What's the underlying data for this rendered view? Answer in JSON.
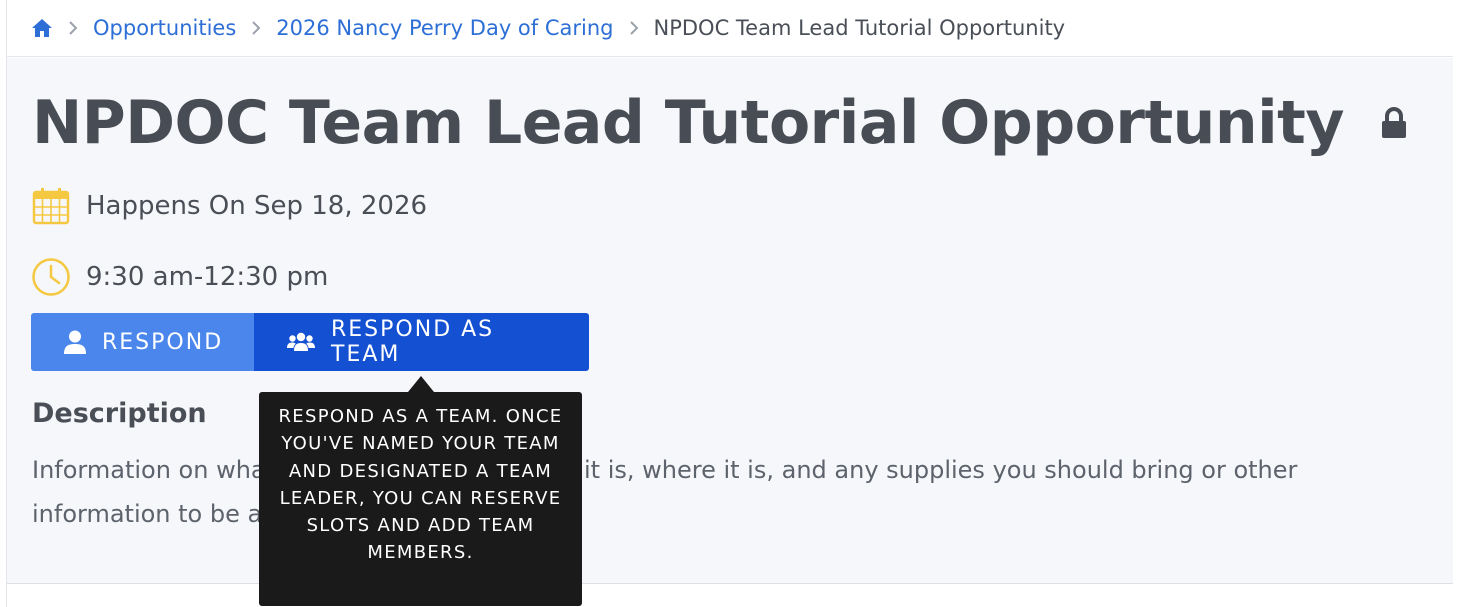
{
  "breadcrumb": {
    "items": [
      {
        "label": "Opportunities"
      },
      {
        "label": "2026 Nancy Perry Day of Caring"
      }
    ],
    "current": "NPDOC Team Lead Tutorial Opportunity"
  },
  "page": {
    "title": "NPDOC Team Lead Tutorial Opportunity",
    "date_text": "Happens On Sep 18, 2026",
    "time_text": "9:30 am-12:30 pm"
  },
  "actions": {
    "respond_label": "RESPOND",
    "respond_team_label": "RESPOND AS TEAM"
  },
  "description": {
    "heading": "Description",
    "text": "Information on what the opportunity is, when it is, where it is, and any supplies you should bring or other information to be aware of."
  },
  "tooltip": {
    "text": "RESPOND AS A TEAM. ONCE YOU'VE NAMED YOUR TEAM AND DESIGNATED A TEAM LEADER, YOU CAN RESERVE SLOTS AND ADD TEAM MEMBERS."
  },
  "icons": {
    "home": "home-icon",
    "separator": "chevron-right-icon",
    "lock": "lock-icon",
    "calendar": "calendar-icon",
    "clock": "clock-icon",
    "user": "user-icon",
    "team": "users-icon"
  },
  "colors": {
    "link": "#2d6fd6",
    "respond_button": "#4a86ec",
    "respond_team_button": "#1450d2",
    "meta_icon": "#f5c842",
    "tooltip_bg": "#1a1a1a"
  }
}
